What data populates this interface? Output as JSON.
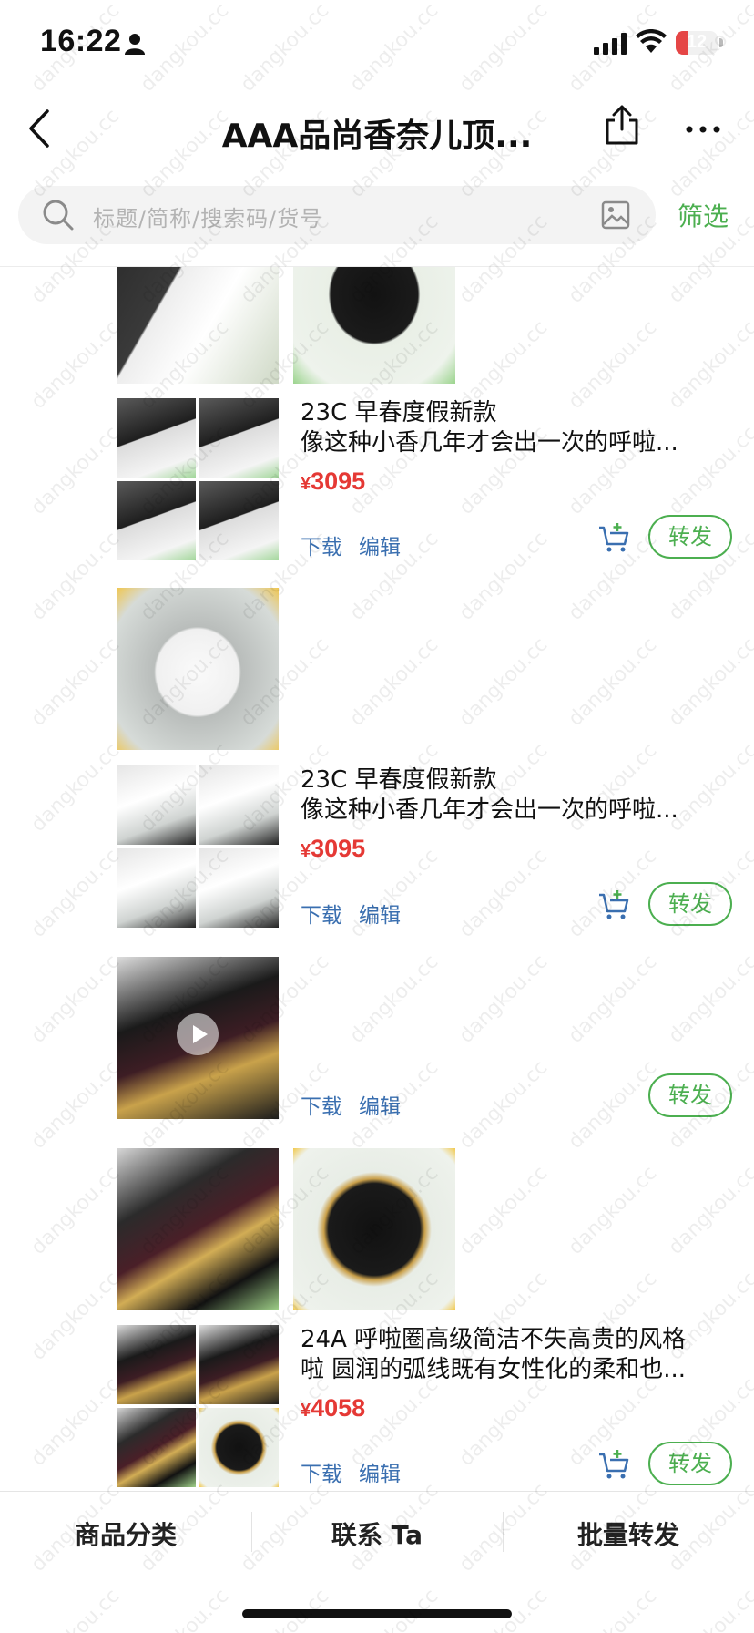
{
  "status_bar": {
    "time": "16:22",
    "battery": "12"
  },
  "nav": {
    "title": "AAA品尚香奈儿顶..."
  },
  "search": {
    "placeholder": "标题/简称/搜索码/货号",
    "filter_label": "筛选"
  },
  "products": [
    {
      "line1": "23C 早春度假新款",
      "line2": "像这种小香几年才会出一次的呼啦...",
      "price_symbol": "¥",
      "price": "3095",
      "download": "下载",
      "edit": "编辑",
      "forward": "转发"
    },
    {
      "line1": "23C 早春度假新款",
      "line2": "像这种小香几年才会出一次的呼啦...",
      "price_symbol": "¥",
      "price": "3095",
      "download": "下载",
      "edit": "编辑",
      "forward": "转发"
    },
    {
      "download": "下载",
      "edit": "编辑",
      "forward": "转发"
    },
    {
      "line1": "24A 呼啦圈高级简洁不失高贵的风格",
      "line2": "啦 圆润的弧线既有女性化的柔和也...",
      "price_symbol": "¥",
      "price": "4058",
      "download": "下载",
      "edit": "编辑",
      "forward": "转发"
    }
  ],
  "bottom_bar": {
    "category": "商品分类",
    "contact": "联系 Ta",
    "batch_forward": "批量转发"
  },
  "watermark": "dangkou.cc",
  "colors": {
    "accent_green": "#4caf50",
    "price_red": "#e53935",
    "link_blue": "#3a6fb0"
  }
}
